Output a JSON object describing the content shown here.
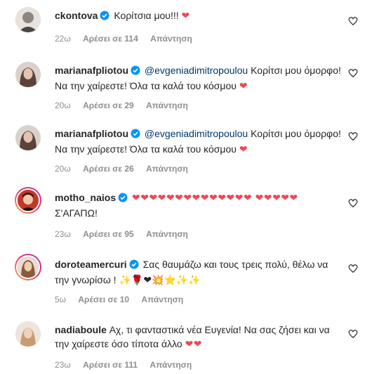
{
  "comments": [
    {
      "username": "ckontova",
      "text": "Κορίτσια μου!!!",
      "heart_suffix": "❤",
      "time": "22ω",
      "likes": "Αρέσει σε 114",
      "reply": "Απάντηση",
      "avatar_color": "#bdb6b0"
    },
    {
      "username": "marianafpliotou",
      "mention": "@evgeniadimitropoulou",
      "text": "Κορίτσι μου όμορφο! Να την χαίρεστε! Όλα τα καλά του κόσμου",
      "heart_suffix": "❤",
      "time": "20ω",
      "likes": "Αρέσει σε 29",
      "reply": "Απάντηση",
      "avatar_color": "#6b5a52"
    },
    {
      "username": "marianafpliotou",
      "mention": "@evgeniadimitropoulou",
      "text": "Κορίτσι μου όμορφο! Να την χαίρεστε! Όλα τα καλά του κόσμου",
      "heart_suffix": "❤",
      "time": "20ω",
      "likes": "Αρέσει σε 26",
      "reply": "Απάντηση",
      "avatar_color": "#6b5a52"
    },
    {
      "username": "motho_naios",
      "hearts": "❤❤❤❤❤❤❤❤❤❤❤❤❤❤ ❤❤❤❤❤",
      "text": "Σ'ΑΓΑΠΩ!",
      "time": "23ω",
      "likes": "Αρέσει σε 95",
      "reply": "Απάντηση",
      "avatar_color": "#b83a2a"
    },
    {
      "username": "doroteamercuri",
      "text": "Σας θαυμάζω και τους τρεις πολύ, θέλω να την γνωρίσω !",
      "emoji_suffix": "✨🌹❤💥⭐✨✨",
      "time": "5ω",
      "likes": "Αρέσει σε 10",
      "reply": "Απάντηση",
      "avatar_color": "#c9a48a"
    },
    {
      "username": "nadiaboule",
      "text": "Αχ, τι φανταστικά νέα Ευγενία! Να σας ζήσει και να την χαίρεστε όσο τίποτα άλλο",
      "heart_suffix": "❤❤",
      "time": "23ω",
      "likes": "Αρέσει σε 111",
      "reply": "Απάντηση",
      "avatar_color": "#d8b79a"
    }
  ],
  "colors": {
    "verified": "#0095f6",
    "heart": "#ed4956",
    "mention": "#00376b",
    "meta": "#8e8e8e"
  }
}
